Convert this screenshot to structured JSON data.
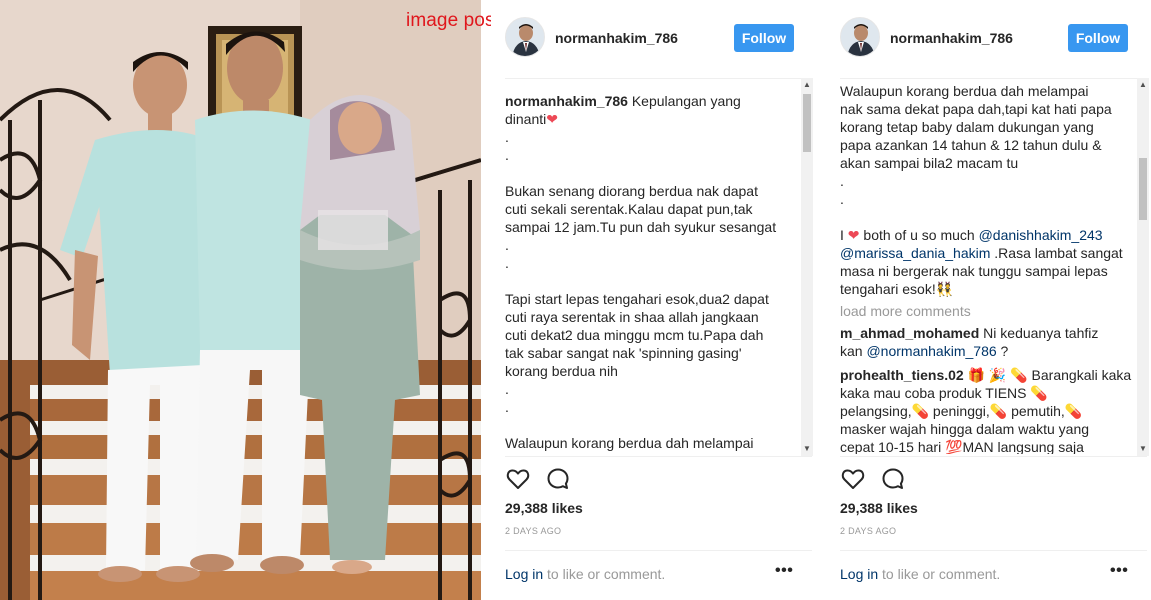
{
  "watermark": "image posted @ www.myartis.com",
  "posts": [
    {
      "username": "normanhakim_786",
      "follow_label": "Follow",
      "caption_user": "normanhakim_786",
      "caption_lines": [
        " Kepulangan yang",
        "dinanti",
        "."
      ],
      "heart": "❤",
      "lines": [
        ".",
        "",
        "Bukan senang diorang berdua nak dapat",
        "cuti sekali serentak.Kalau dapat pun,tak",
        "sampai 12 jam.Tu pun dah syukur sesangat",
        ".",
        ".",
        "",
        "Tapi start lepas tengahari esok,dua2 dapat",
        "cuti raya serentak in shaa allah jangkaan",
        "cuti dekat2 dua minggu mcm tu.Papa dah",
        "tak sabar sangat nak 'spinning gasing'",
        "korang berdua nih",
        ".",
        ".",
        "",
        "Walaupun korang berdua dah melampai"
      ],
      "likes": "29,388 likes",
      "timestamp": "2 DAYS AGO",
      "login_link": "Log in",
      "login_rest": " to like or comment.",
      "more": "•••"
    },
    {
      "username": "normanhakim_786",
      "follow_label": "Follow",
      "lines": [
        "Walaupun korang berdua dah melampai",
        "nak sama dekat papa dah,tapi kat hati papa",
        "korang tetap baby dalam dukungan yang",
        "papa azankan 14 tahun & 12 tahun dulu &",
        "akan sampai bila2 macam tu",
        ".",
        ".",
        ""
      ],
      "love_line": {
        "pre": "I ",
        "heart": "❤",
        "mid": " both of u so much ",
        "mention1": "@danishhakim_243",
        "mention2": "@marissa_dania_hakim",
        "rest1": " .Rasa lambat sangat",
        "rest2": "masa ni bergerak nak tunggu sampai lepas",
        "rest3": "tengahari esok!",
        "emoji": "👯"
      },
      "load_more": "load more comments",
      "comment1": {
        "user": "m_ahmad_mohamed",
        "text1": " Ni keduanya tahfiz",
        "text2_pre": "kan ",
        "mention": "@normanhakim_786",
        "text2_post": " ?"
      },
      "comment2": {
        "user": "prohealth_tiens.02",
        "emoji1": " 🎁 🎉 💊",
        "text1": " Barangkali kaka",
        "text2": "kaka mau coba produk TIENS 💊",
        "text3": "pelangsing,💊 peninggi,💊 pemutih,💊",
        "text4": "masker wajah hingga dalam waktu yang",
        "text5": "cepat 10-15 hari  💯MAN  langsung saja"
      },
      "likes": "29,388 likes",
      "timestamp": "2 DAYS AGO",
      "login_link": "Log in",
      "login_rest": " to like or comment.",
      "more": "•••"
    }
  ]
}
